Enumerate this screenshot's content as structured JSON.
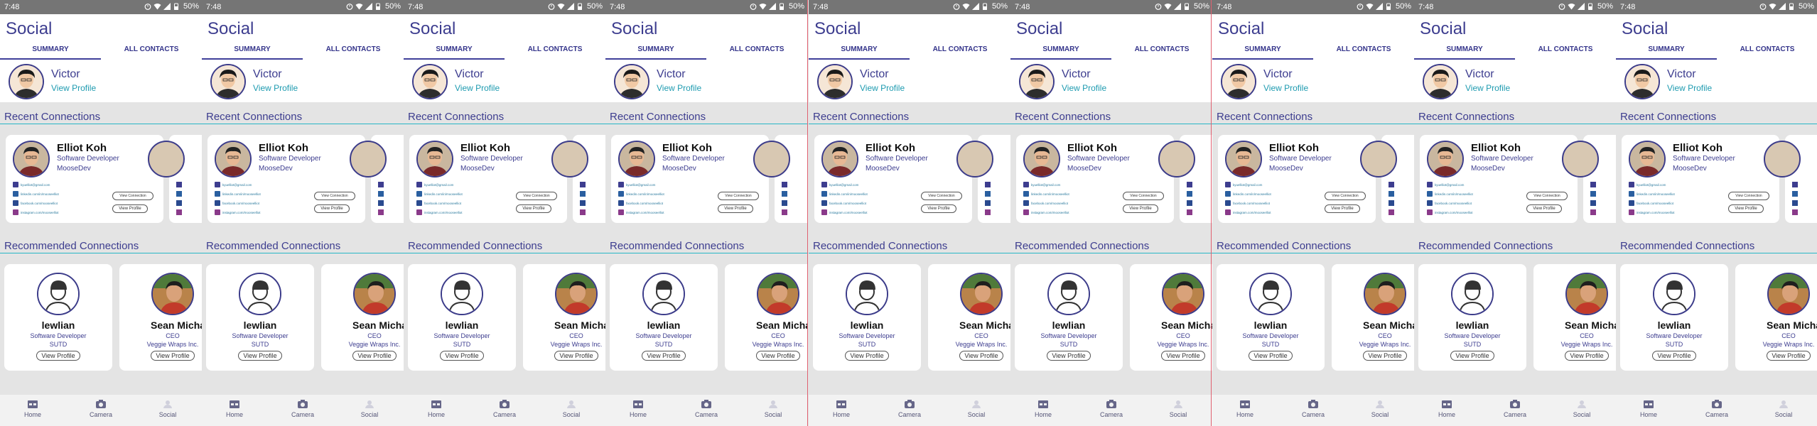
{
  "status": {
    "time": "7:48",
    "battery": "50%"
  },
  "app": {
    "title": "Social"
  },
  "tabs": [
    {
      "label": "SUMMARY"
    },
    {
      "label": "ALL CONTACTS"
    }
  ],
  "me": {
    "name": "Victor",
    "link": "View Profile"
  },
  "sections": {
    "recent": "Recent Connections",
    "recommended": "Recommended Connections"
  },
  "connection": {
    "name": "Elliot Koh",
    "role": "Software Developer",
    "company": "MooseDev",
    "contacts": [
      {
        "icon": "email-icon",
        "text": "kyuelliot@gmail.com"
      },
      {
        "icon": "linkedin-icon",
        "text": "linkedin.com/in/mooseelliot"
      },
      {
        "icon": "facebook-icon",
        "text": "facebook.com/mooseelliot"
      },
      {
        "icon": "instagram-icon",
        "text": "instagram.com/mooseelliot"
      }
    ],
    "view_connection": "View Connection",
    "view_profile": "View Profile"
  },
  "recommended": [
    {
      "name": "lewlian",
      "role": "Software Developer",
      "org": "SUTD",
      "button": "View Profile"
    },
    {
      "name": "Sean Michael Li",
      "role": "CEO",
      "org": "Veggie Wraps Inc.",
      "button": "View Profile"
    }
  ],
  "nav": [
    {
      "label": "Home",
      "icon": "home-icon"
    },
    {
      "label": "Camera",
      "icon": "camera-icon"
    },
    {
      "label": "Social",
      "icon": "social-icon"
    }
  ],
  "colors": {
    "primary": "#3d3d8f",
    "accent": "#1e9bb0",
    "divider_line": "#27b6c6",
    "statusbar": "#757575"
  },
  "frame_count": 9
}
